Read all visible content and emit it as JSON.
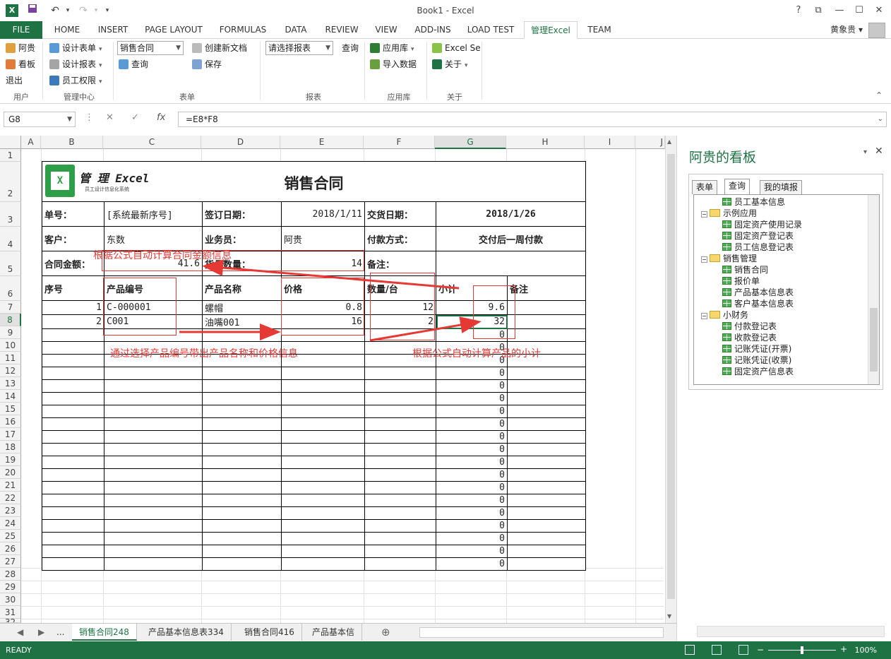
{
  "titlebar": {
    "title": "Book1 - Excel",
    "app_icon": "X",
    "undo_icon": "↶",
    "redo_icon": "↷",
    "save_icon": "💾",
    "more_icon": "▾",
    "help": "?",
    "restore": "⧉",
    "minimize": "—",
    "maximize": "☐",
    "close": "✕"
  },
  "ribbon_tabs": {
    "file": "FILE",
    "items": [
      "HOME",
      "INSERT",
      "PAGE LAYOUT",
      "FORMULAS",
      "DATA",
      "REVIEW",
      "VIEW",
      "ADD-INS",
      "LOAD TEST",
      "管理Excel",
      "TEAM"
    ],
    "active": "管理Excel",
    "user": "黄象贵 ▾"
  },
  "ribbon": {
    "user_group": {
      "label": "用户",
      "items": [
        "阿贵",
        "看板",
        "退出"
      ]
    },
    "mgmt_group": {
      "label": "管理中心",
      "items": [
        "设计表单",
        "设计报表",
        "员工权限"
      ]
    },
    "form_group": {
      "label": "表单",
      "combo": "销售合同",
      "query": "查询",
      "new_doc": "创建新文档",
      "save": "保存"
    },
    "report_group": {
      "label": "报表",
      "combo_placeholder": "请选择报表",
      "query": "查询"
    },
    "applib_group": {
      "label": "应用库",
      "applib": "应用库",
      "import": "导入数据"
    },
    "about_group": {
      "label": "关于",
      "excel_se": "Excel Se",
      "about": "关于"
    },
    "collapse": "⌃"
  },
  "formula_bar": {
    "cell": "G8",
    "formula": "=E8*F8",
    "cancel": "✕",
    "enter": "✓",
    "fx": "fx",
    "dots": "⋮",
    "expand": "⌄"
  },
  "columns": [
    "A",
    "B",
    "C",
    "D",
    "E",
    "F",
    "G",
    "H",
    "I",
    "J"
  ],
  "rows": [
    "1",
    "2",
    "3",
    "4",
    "5",
    "6",
    "7",
    "8",
    "9",
    "10",
    "11",
    "12",
    "13",
    "14",
    "15",
    "16",
    "17",
    "18",
    "19",
    "20",
    "21",
    "22",
    "23",
    "24",
    "25",
    "26",
    "27",
    "28",
    "29",
    "30",
    "31",
    "32"
  ],
  "form": {
    "logo_title": "管 理 Excel",
    "logo_sub": "员工设计信息化系统",
    "title": "销售合同",
    "order_no_label": "单号：",
    "order_no": "[系统最新序号]",
    "sign_date_label": "签订日期：",
    "sign_date": "2018/1/11",
    "delivery_label": "交货日期：",
    "delivery": "2018/1/26",
    "customer_label": "客户：",
    "customer": "东数",
    "sales_label": "业务员：",
    "sales": "阿贵",
    "pay_label": "付款方式：",
    "pay": "交付后一周付款",
    "amount_label": "合同金额：",
    "amount": "41.6",
    "qty_label": "货品数量：",
    "qty": "14",
    "note_label": "备注：",
    "headers": [
      "序号",
      "产品编号",
      "产品名称",
      "价格",
      "数量/台",
      "小计",
      "备注"
    ],
    "lines": [
      {
        "no": "1",
        "code": "C-000001",
        "name": "螺帽",
        "price": "0.8",
        "qty": "12",
        "sub": "9.6"
      },
      {
        "no": "2",
        "code": "C001",
        "name": "油嘴001",
        "price": "16",
        "qty": "2",
        "sub": "32"
      }
    ],
    "zero": "0"
  },
  "annotations": {
    "amount_note": "根据公式自动计算合同金额信息",
    "product_note": "通过选择产品编号带出产品名称和价格信息",
    "subtotal_note": "根据公式自动计算产品的小计"
  },
  "sheet_tabs": {
    "prev": "◀",
    "next": "▶",
    "more": "...",
    "items": [
      "销售合同248",
      "产品基本信息表334",
      "销售合同416",
      "产品基本信"
    ],
    "active": "销售合同248",
    "add": "⊕"
  },
  "pane": {
    "title": "阿贵的看板",
    "tabs": [
      "表单",
      "查询",
      "我的填报"
    ],
    "active_tab": "查询",
    "tree": [
      {
        "label": "员工基本信息",
        "type": "table",
        "level": 2
      },
      {
        "label": "示例应用",
        "type": "folder",
        "level": 1
      },
      {
        "label": "固定资产使用记录",
        "type": "table",
        "level": 2
      },
      {
        "label": "固定资产登记表",
        "type": "table",
        "level": 2
      },
      {
        "label": "员工信息登记表",
        "type": "table",
        "level": 2
      },
      {
        "label": "销售管理",
        "type": "folder",
        "level": 1
      },
      {
        "label": "销售合同",
        "type": "table",
        "level": 2
      },
      {
        "label": "报价单",
        "type": "table",
        "level": 2
      },
      {
        "label": "产品基本信息表",
        "type": "table",
        "level": 2
      },
      {
        "label": "客户基本信息表",
        "type": "table",
        "level": 2
      },
      {
        "label": "小财务",
        "type": "folder",
        "level": 1
      },
      {
        "label": "付款登记表",
        "type": "table",
        "level": 2
      },
      {
        "label": "收款登记表",
        "type": "table",
        "level": 2
      },
      {
        "label": "记账凭证(开票)",
        "type": "table",
        "level": 2
      },
      {
        "label": "记账凭证(收票)",
        "type": "table",
        "level": 2
      },
      {
        "label": "固定资产信息表",
        "type": "table",
        "level": 2
      }
    ],
    "close": "✕",
    "menu": "▾",
    "minus": "−"
  },
  "status": {
    "text": "READY",
    "zoom": "100%",
    "minus": "−",
    "plus": "+"
  },
  "colors": {
    "excel_green": "#1f7244",
    "annotation_red": "#e53935"
  }
}
